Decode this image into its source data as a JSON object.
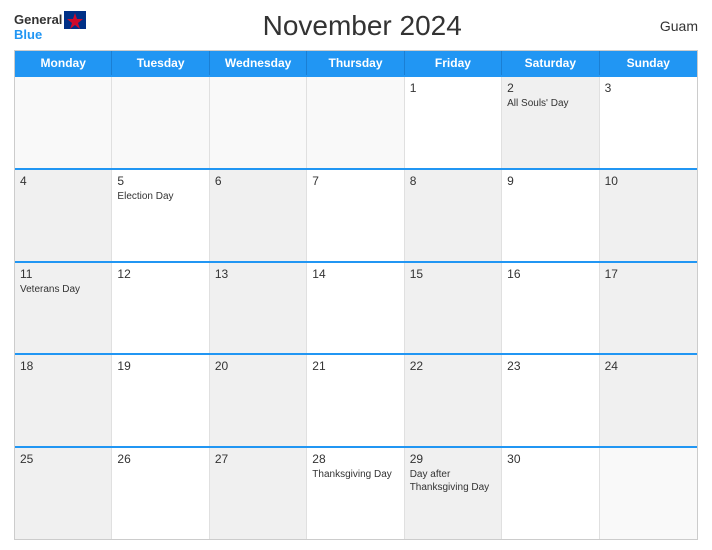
{
  "header": {
    "title": "November 2024",
    "region": "Guam",
    "logo_general": "General",
    "logo_blue": "Blue"
  },
  "weekdays": [
    "Monday",
    "Tuesday",
    "Wednesday",
    "Thursday",
    "Friday",
    "Saturday",
    "Sunday"
  ],
  "weeks": [
    [
      {
        "day": "",
        "events": [],
        "empty": true
      },
      {
        "day": "",
        "events": [],
        "empty": true
      },
      {
        "day": "",
        "events": [],
        "empty": true
      },
      {
        "day": "",
        "events": [],
        "empty": true
      },
      {
        "day": "1",
        "events": []
      },
      {
        "day": "2",
        "events": [
          "All Souls' Day"
        ],
        "shaded": true
      },
      {
        "day": "3",
        "events": []
      }
    ],
    [
      {
        "day": "4",
        "events": [],
        "shaded": true
      },
      {
        "day": "5",
        "events": [
          "Election Day"
        ]
      },
      {
        "day": "6",
        "events": [],
        "shaded": true
      },
      {
        "day": "7",
        "events": []
      },
      {
        "day": "8",
        "events": [],
        "shaded": true
      },
      {
        "day": "9",
        "events": []
      },
      {
        "day": "10",
        "events": [],
        "shaded": true
      }
    ],
    [
      {
        "day": "11",
        "events": [
          "Veterans Day"
        ],
        "shaded": true
      },
      {
        "day": "12",
        "events": []
      },
      {
        "day": "13",
        "events": [],
        "shaded": true
      },
      {
        "day": "14",
        "events": []
      },
      {
        "day": "15",
        "events": [],
        "shaded": true
      },
      {
        "day": "16",
        "events": []
      },
      {
        "day": "17",
        "events": [],
        "shaded": true
      }
    ],
    [
      {
        "day": "18",
        "events": [],
        "shaded": true
      },
      {
        "day": "19",
        "events": []
      },
      {
        "day": "20",
        "events": [],
        "shaded": true
      },
      {
        "day": "21",
        "events": []
      },
      {
        "day": "22",
        "events": [],
        "shaded": true
      },
      {
        "day": "23",
        "events": []
      },
      {
        "day": "24",
        "events": [],
        "shaded": true
      }
    ],
    [
      {
        "day": "25",
        "events": [],
        "shaded": true
      },
      {
        "day": "26",
        "events": []
      },
      {
        "day": "27",
        "events": [],
        "shaded": true
      },
      {
        "day": "28",
        "events": [
          "Thanksgiving Day"
        ]
      },
      {
        "day": "29",
        "events": [
          "Day after",
          "Thanksgiving Day"
        ],
        "shaded": true
      },
      {
        "day": "30",
        "events": []
      },
      {
        "day": "",
        "events": [],
        "empty": true
      }
    ]
  ],
  "colors": {
    "header_bg": "#2196F3",
    "accent": "#2196F3"
  }
}
